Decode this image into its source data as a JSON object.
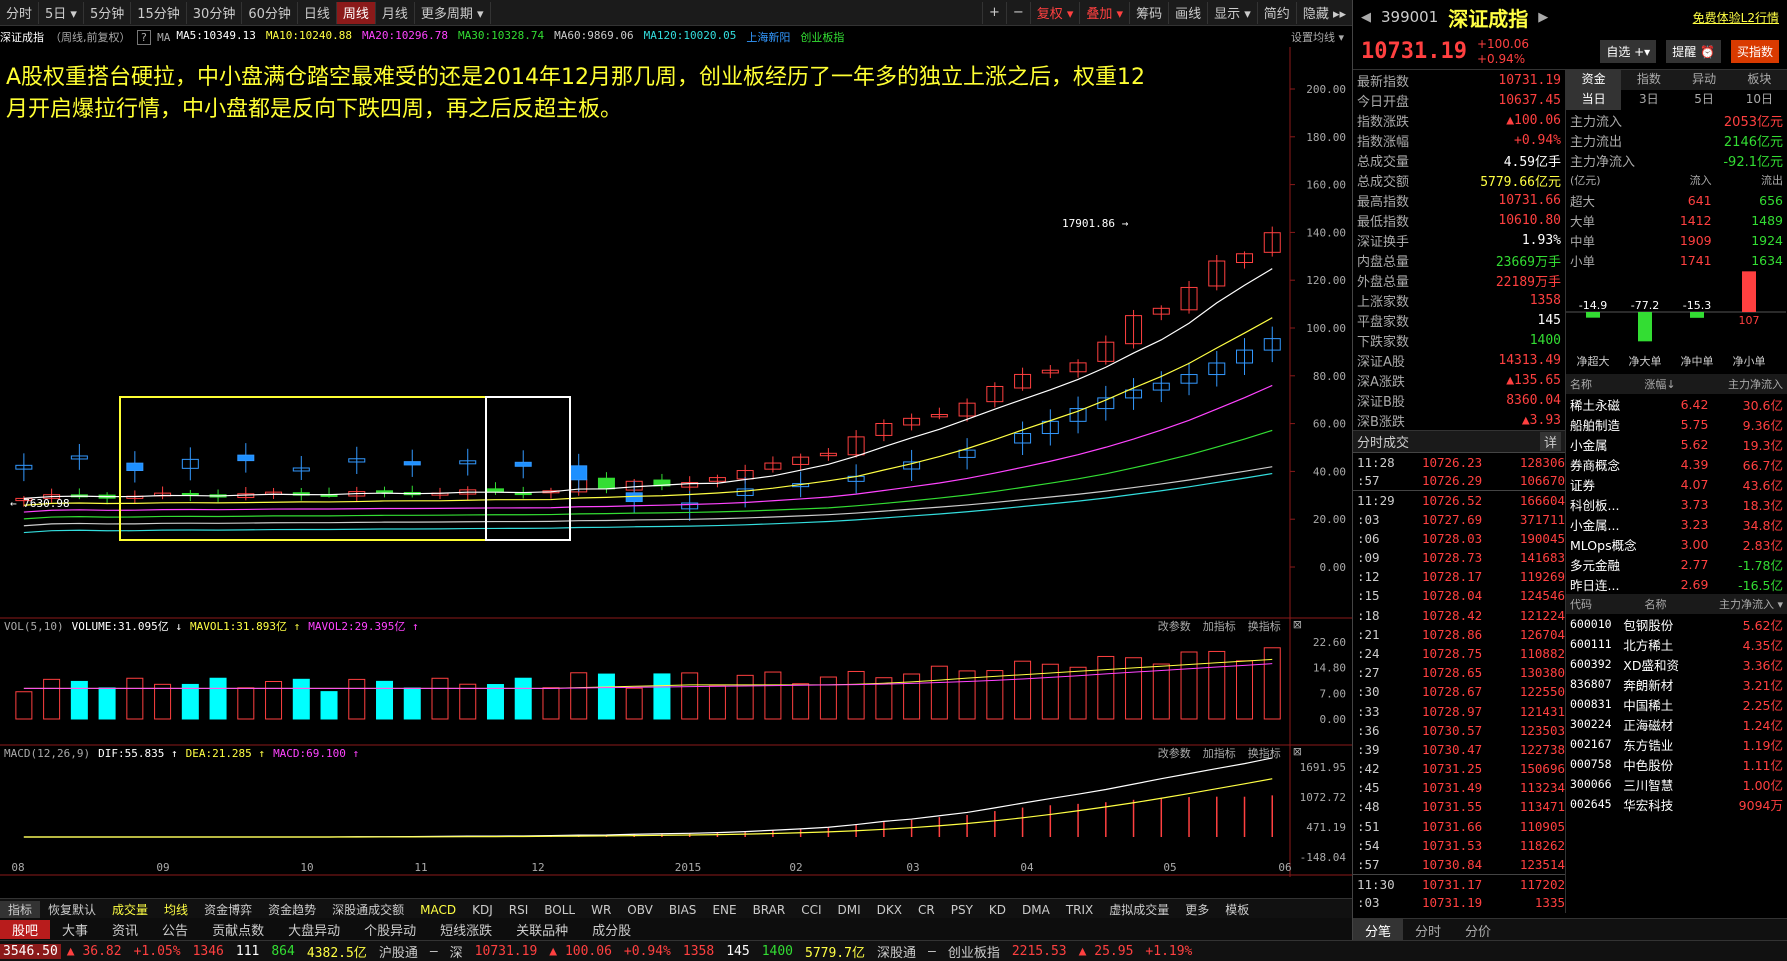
{
  "toolbar": {
    "periods": [
      "分时",
      "5日 ▾",
      "5分钟",
      "15分钟",
      "30分钟",
      "60分钟",
      "日线",
      "周线",
      "月线",
      "更多周期 ▾"
    ],
    "active_index": 7,
    "tools": [
      "+",
      "−",
      "复权 ▾",
      "叠加 ▾",
      "筹码",
      "画线",
      "显示 ▾",
      "简约",
      "隐藏 ▸▸"
    ],
    "tools_red": [
      2,
      3
    ]
  },
  "indicator_bar": {
    "name": "深证成指",
    "mode": "（周线,前复权）",
    "help": "?",
    "ma_label": "MA",
    "items": [
      {
        "text": "MA5:10349.13",
        "color": "#ffffff"
      },
      {
        "text": "MA10:10240.88",
        "color": "#ffff44"
      },
      {
        "text": "MA20:10296.78",
        "color": "#ff44ff"
      },
      {
        "text": "MA30:10328.74",
        "color": "#33dd33"
      },
      {
        "text": "MA60:9869.06",
        "color": "#cccccc"
      },
      {
        "text": "MA120:10020.05",
        "color": "#33dddd"
      },
      {
        "text": "上海新阳",
        "color": "#3399ff"
      },
      {
        "text": "创业板指",
        "color": "#33dd33"
      }
    ],
    "settings": "设置均线 ▾"
  },
  "annotation": "A股权重搭台硬拉，中小盘满仓踏空最难受的还是2014年12月那几周，创业板经历了一年多的独立上涨之后，权重12月开启爆拉行情，中小盘都是反向下跌四周，再之后反超主板。",
  "main_axis": {
    "labels": [
      "200.00",
      "180.00",
      "160.00",
      "140.00",
      "120.00",
      "100.00",
      "80.00",
      "60.00",
      "40.00",
      "20.00",
      "0.00"
    ],
    "high_label": "17901.86 →",
    "low_label": "← 7630.98"
  },
  "vol_panel": {
    "title": "VOL(5,10)",
    "volume": "VOLUME:31.095亿 ↓",
    "mavol1": "MAVOL1:31.893亿 ↑",
    "mavol2": "MAVOL2:29.395亿 ↑",
    "axis": [
      "22.60",
      "14.80",
      "7.00",
      "0.00"
    ],
    "actions": [
      "改参数",
      "加指标",
      "换指标",
      "⊠"
    ]
  },
  "macd_panel": {
    "title": "MACD(12,26,9)",
    "dif": "DIF:55.835 ↑",
    "dea": "DEA:21.285 ↑",
    "macd": "MACD:69.100 ↑",
    "axis": [
      "1691.95",
      "1072.72",
      "471.19",
      "-148.04"
    ],
    "actions": [
      "改参数",
      "加指标",
      "换指标",
      "⊠"
    ]
  },
  "x_axis": [
    "08",
    "09",
    "10",
    "11",
    "12",
    "2015",
    "02",
    "03",
    "04",
    "05",
    "06"
  ],
  "indicator_tabs": [
    "指标",
    "恢复默认",
    "成交量",
    "均线",
    "资金博弈",
    "资金趋势",
    "深股通成交额",
    "MACD",
    "KDJ",
    "RSI",
    "BOLL",
    "WR",
    "OBV",
    "BIAS",
    "ENE",
    "BRAR",
    "CCI",
    "DMI",
    "DKX",
    "CR",
    "PSY",
    "KD",
    "DMA",
    "TRIX",
    "虚拟成交量",
    "更多",
    "模板"
  ],
  "news_tabs": [
    "股吧",
    "大事",
    "资讯",
    "公告",
    "贡献点数",
    "大盘异动",
    "个股异动",
    "短线涨跌",
    "关联品种",
    "成分股"
  ],
  "right": {
    "code": "399001",
    "name": "深证成指",
    "link": "免费体验L2行情",
    "price": "10731.19",
    "change": "+100.06",
    "pct": "+0.94%",
    "buttons": [
      "自选 +▾",
      "提醒 ⏰",
      "买指数"
    ],
    "stats": [
      {
        "k": "最新指数",
        "v": "10731.19",
        "c": "red"
      },
      {
        "k": "今日开盘",
        "v": "10637.45",
        "c": "red"
      },
      {
        "k": "指数涨跌",
        "v": "▲100.06",
        "c": "red"
      },
      {
        "k": "指数涨幅",
        "v": "+0.94%",
        "c": "red"
      },
      {
        "k": "总成交量",
        "v": "4.59亿手",
        "c": "white"
      },
      {
        "k": "总成交额",
        "v": "5779.66亿元",
        "c": "yellow"
      },
      {
        "k": "最高指数",
        "v": "10731.66",
        "c": "red"
      },
      {
        "k": "最低指数",
        "v": "10610.80",
        "c": "red"
      },
      {
        "k": "深证换手",
        "v": "1.93%",
        "c": "white"
      },
      {
        "k": "内盘总量",
        "v": "23669万手",
        "c": "green"
      },
      {
        "k": "外盘总量",
        "v": "22189万手",
        "c": "red"
      },
      {
        "k": "上涨家数",
        "v": "1358",
        "c": "red"
      },
      {
        "k": "平盘家数",
        "v": "145",
        "c": "white"
      },
      {
        "k": "下跌家数",
        "v": "1400",
        "c": "green"
      },
      {
        "k": "深证A股",
        "v": "14313.49",
        "c": "red"
      },
      {
        "k": "深A涨跌",
        "v": "▲135.65",
        "c": "red"
      },
      {
        "k": "深证B股",
        "v": "8360.04",
        "c": "red"
      },
      {
        "k": "深B涨跌",
        "v": "▲3.93",
        "c": "red"
      }
    ],
    "fund_tabs": [
      "资金",
      "指数",
      "异动",
      "板块"
    ],
    "fund_subtabs": [
      "当日",
      "3日",
      "5日",
      "10日"
    ],
    "fund_rows": [
      {
        "k": "主力流入",
        "v": "2053亿元",
        "c": "red"
      },
      {
        "k": "主力流出",
        "v": "2146亿元",
        "c": "green"
      },
      {
        "k": "主力净流入",
        "v": "-92.1亿元",
        "c": "green"
      }
    ],
    "flow_header": [
      "(亿元)",
      "流入",
      "流出"
    ],
    "flow_rows": [
      {
        "k": "超大",
        "in": "641",
        "out": "656"
      },
      {
        "k": "大单",
        "in": "1412",
        "out": "1489"
      },
      {
        "k": "中单",
        "in": "1909",
        "out": "1924"
      },
      {
        "k": "小单",
        "in": "1741",
        "out": "1634"
      }
    ],
    "net_bars": [
      {
        "label": "净超大",
        "value": "-14.9",
        "num": -14.9
      },
      {
        "label": "净大单",
        "value": "-77.2",
        "num": -77.2
      },
      {
        "label": "净中单",
        "value": "-15.3",
        "num": -15.3
      },
      {
        "label": "净小单",
        "value": "107",
        "num": 107
      }
    ],
    "sector_header": [
      "名称",
      "涨幅↓",
      "主力净流入"
    ],
    "sectors": [
      {
        "n": "稀土永磁",
        "p": "6.42",
        "f": "30.6亿"
      },
      {
        "n": "船舶制造",
        "p": "5.75",
        "f": "9.36亿"
      },
      {
        "n": "小金属",
        "p": "5.62",
        "f": "19.3亿"
      },
      {
        "n": "券商概念",
        "p": "4.39",
        "f": "66.7亿"
      },
      {
        "n": "证券",
        "p": "4.07",
        "f": "43.6亿"
      },
      {
        "n": "科创板...",
        "p": "3.73",
        "f": "18.3亿"
      },
      {
        "n": "小金属...",
        "p": "3.23",
        "f": "34.8亿"
      },
      {
        "n": "MLOps概念",
        "p": "3.00",
        "f": "2.83亿"
      },
      {
        "n": "多元金融",
        "p": "2.77",
        "f": "-1.78亿"
      },
      {
        "n": "昨日连...",
        "p": "2.69",
        "f": "-16.5亿"
      }
    ],
    "stock_header": [
      "代码",
      "名称",
      "主力净流入 ▾"
    ],
    "stocks": [
      {
        "c": "600010",
        "n": "包钢股份",
        "f": "5.62亿"
      },
      {
        "c": "600111",
        "n": "北方稀土",
        "f": "4.35亿"
      },
      {
        "c": "600392",
        "n": "XD盛和资",
        "f": "3.36亿"
      },
      {
        "c": "836807",
        "n": "奔朗新材",
        "f": "3.21亿"
      },
      {
        "c": "000831",
        "n": "中国稀土",
        "f": "2.25亿"
      },
      {
        "c": "300224",
        "n": "正海磁材",
        "f": "1.24亿"
      },
      {
        "c": "002167",
        "n": "东方锆业",
        "f": "1.19亿"
      },
      {
        "c": "000758",
        "n": "中色股份",
        "f": "1.11亿"
      },
      {
        "c": "300066",
        "n": "三川智慧",
        "f": "1.00亿"
      },
      {
        "c": "002645",
        "n": "华宏科技",
        "f": "9094万"
      }
    ],
    "ticks_title": "分时成交",
    "ticks_more": "详",
    "ticks": [
      {
        "t": "11:28",
        "p": "10726.23",
        "v": "128306"
      },
      {
        "t": ":57",
        "p": "10726.29",
        "v": "106670"
      },
      {
        "t": "11:29",
        "p": "10726.52",
        "v": "166604"
      },
      {
        "t": ":03",
        "p": "10727.69",
        "v": "371711"
      },
      {
        "t": ":06",
        "p": "10728.03",
        "v": "190045"
      },
      {
        "t": ":09",
        "p": "10728.73",
        "v": "141683"
      },
      {
        "t": ":12",
        "p": "10728.17",
        "v": "119269"
      },
      {
        "t": ":15",
        "p": "10728.04",
        "v": "124546"
      },
      {
        "t": ":18",
        "p": "10728.42",
        "v": "121224"
      },
      {
        "t": ":21",
        "p": "10728.86",
        "v": "126704"
      },
      {
        "t": ":24",
        "p": "10728.75",
        "v": "110882"
      },
      {
        "t": ":27",
        "p": "10728.65",
        "v": "130380"
      },
      {
        "t": ":30",
        "p": "10728.67",
        "v": "122550"
      },
      {
        "t": ":33",
        "p": "10728.97",
        "v": "121431"
      },
      {
        "t": ":36",
        "p": "10730.57",
        "v": "123503"
      },
      {
        "t": ":39",
        "p": "10730.47",
        "v": "122738"
      },
      {
        "t": ":42",
        "p": "10731.25",
        "v": "150696"
      },
      {
        "t": ":45",
        "p": "10731.49",
        "v": "113234"
      },
      {
        "t": ":48",
        "p": "10731.55",
        "v": "113471"
      },
      {
        "t": ":51",
        "p": "10731.66",
        "v": "110905"
      },
      {
        "t": ":54",
        "p": "10731.53",
        "v": "118262"
      },
      {
        "t": ":57",
        "p": "10730.84",
        "v": "123514"
      },
      {
        "t": "11:30",
        "p": "10731.17",
        "v": "117202"
      },
      {
        "t": ":03",
        "p": "10731.19",
        "v": "1335"
      }
    ],
    "bottom_tabs": [
      "分笔",
      "分时",
      "分价"
    ]
  },
  "status": {
    "sh": "3546.50",
    "sh_chg": "▲ 36.82",
    "sh_pct": "+1.05%",
    "sh_up": "1346",
    "sh_flat": "111",
    "sh_down": "864",
    "sh_amt": "4382.5亿",
    "hgt": "沪股通",
    "hgt_val": "—",
    "sz_label": "深",
    "sz": "10731.19",
    "sz_chg": "▲ 100.06",
    "sz_pct": "+0.94%",
    "sz_up": "1358",
    "sz_flat": "145",
    "sz_down": "1400",
    "sz_amt": "5779.7亿",
    "sgt": "深股通",
    "sgt_val": "—",
    "cyb_label": "创业板指",
    "cyb": "2215.53",
    "cyb_chg": "▲ 25.95",
    "cyb_pct": "+1.19%"
  },
  "colors": {
    "up": "#ff4040",
    "down": "#33dd33",
    "cyan_candle": "#00ffff",
    "highlight_box": "#ffff33"
  }
}
